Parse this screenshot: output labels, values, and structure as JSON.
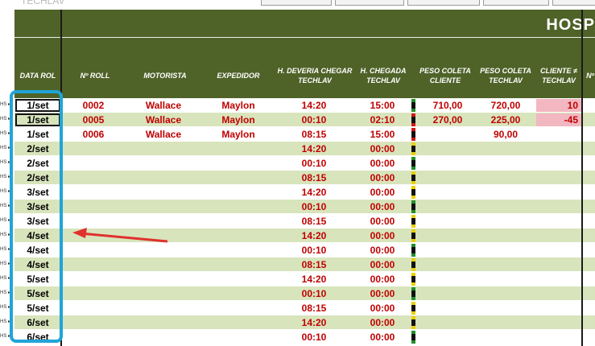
{
  "ghost_text": "TECHLAV",
  "title": "HOSP",
  "columns": {
    "data_rol": "DATA ROL",
    "n_roll": "Nº ROLL",
    "motorista": "MOTORISTA",
    "expedidor": "EXPEDIDOR",
    "h_deveria_l1": "H. DEVERIA CHEGAR",
    "h_deveria_l2": "TECHLAV",
    "h_chegada_l1": "H. CHEGADA",
    "h_chegada_l2": "TECHLAV",
    "peso_cliente_l1": "PESO COLETA",
    "peso_cliente_l2": "CLIENTE",
    "peso_techlav_l1": "PESO COLETA",
    "peso_techlav_l2": "TECHLAV",
    "dif_l1": "CLIENTE ≠",
    "dif_l2": "TECHLAV",
    "extra": "Nº"
  },
  "colors": {
    "header_green": "#4f6228",
    "row_stripe": "#d8e4bc",
    "highlight": "#1fa5d8",
    "text_red": "#c00000"
  },
  "rows": [
    {
      "date": "1/set",
      "roll": "0002",
      "motorista": "Wallace",
      "expedidor": "Maylon",
      "h_deveria": "14:20",
      "h_chegada": "15:00",
      "peso_cliente": "710,00",
      "peso_techlav": "720,00",
      "dif": "10",
      "flag": "green"
    },
    {
      "date": "1/set",
      "roll": "0005",
      "motorista": "Wallace",
      "expedidor": "Maylon",
      "h_deveria": "00:10",
      "h_chegada": "02:10",
      "peso_cliente": "270,00",
      "peso_techlav": "225,00",
      "dif": "-45",
      "flag": "red"
    },
    {
      "date": "1/set",
      "roll": "0006",
      "motorista": "Wallace",
      "expedidor": "Maylon",
      "h_deveria": "08:15",
      "h_chegada": "15:00",
      "peso_cliente": "",
      "peso_techlav": "90,00",
      "dif": "",
      "flag": "red"
    },
    {
      "date": "2/set",
      "roll": "",
      "motorista": "",
      "expedidor": "",
      "h_deveria": "14:20",
      "h_chegada": "00:00",
      "peso_cliente": "",
      "peso_techlav": "",
      "dif": "",
      "flag": "yellow"
    },
    {
      "date": "2/set",
      "roll": "",
      "motorista": "",
      "expedidor": "",
      "h_deveria": "00:10",
      "h_chegada": "00:00",
      "peso_cliente": "",
      "peso_techlav": "",
      "dif": "",
      "flag": "green"
    },
    {
      "date": "2/set",
      "roll": "",
      "motorista": "",
      "expedidor": "",
      "h_deveria": "08:15",
      "h_chegada": "00:00",
      "peso_cliente": "",
      "peso_techlav": "",
      "dif": "",
      "flag": "yellow"
    },
    {
      "date": "3/set",
      "roll": "",
      "motorista": "",
      "expedidor": "",
      "h_deveria": "14:20",
      "h_chegada": "00:00",
      "peso_cliente": "",
      "peso_techlav": "",
      "dif": "",
      "flag": "yellow"
    },
    {
      "date": "3/set",
      "roll": "",
      "motorista": "",
      "expedidor": "",
      "h_deveria": "00:10",
      "h_chegada": "00:00",
      "peso_cliente": "",
      "peso_techlav": "",
      "dif": "",
      "flag": "green"
    },
    {
      "date": "3/set",
      "roll": "",
      "motorista": "",
      "expedidor": "",
      "h_deveria": "08:15",
      "h_chegada": "00:00",
      "peso_cliente": "",
      "peso_techlav": "",
      "dif": "",
      "flag": "yellow"
    },
    {
      "date": "4/set",
      "roll": "",
      "motorista": "",
      "expedidor": "",
      "h_deveria": "14:20",
      "h_chegada": "00:00",
      "peso_cliente": "",
      "peso_techlav": "",
      "dif": "",
      "flag": "yellow"
    },
    {
      "date": "4/set",
      "roll": "",
      "motorista": "",
      "expedidor": "",
      "h_deveria": "00:10",
      "h_chegada": "00:00",
      "peso_cliente": "",
      "peso_techlav": "",
      "dif": "",
      "flag": "green"
    },
    {
      "date": "4/set",
      "roll": "",
      "motorista": "",
      "expedidor": "",
      "h_deveria": "08:15",
      "h_chegada": "00:00",
      "peso_cliente": "",
      "peso_techlav": "",
      "dif": "",
      "flag": "yellow"
    },
    {
      "date": "5/set",
      "roll": "",
      "motorista": "",
      "expedidor": "",
      "h_deveria": "14:20",
      "h_chegada": "00:00",
      "peso_cliente": "",
      "peso_techlav": "",
      "dif": "",
      "flag": "yellow"
    },
    {
      "date": "5/set",
      "roll": "",
      "motorista": "",
      "expedidor": "",
      "h_deveria": "00:10",
      "h_chegada": "00:00",
      "peso_cliente": "",
      "peso_techlav": "",
      "dif": "",
      "flag": "green"
    },
    {
      "date": "5/set",
      "roll": "",
      "motorista": "",
      "expedidor": "",
      "h_deveria": "08:15",
      "h_chegada": "00:00",
      "peso_cliente": "",
      "peso_techlav": "",
      "dif": "",
      "flag": "yellow"
    },
    {
      "date": "6/set",
      "roll": "",
      "motorista": "",
      "expedidor": "",
      "h_deveria": "14:20",
      "h_chegada": "00:00",
      "peso_cliente": "",
      "peso_techlav": "",
      "dif": "",
      "flag": "yellow"
    },
    {
      "date": "6/set",
      "roll": "",
      "motorista": "",
      "expedidor": "",
      "h_deveria": "00:10",
      "h_chegada": "00:00",
      "peso_cliente": "",
      "peso_techlav": "",
      "dif": "",
      "flag": "green"
    }
  ]
}
